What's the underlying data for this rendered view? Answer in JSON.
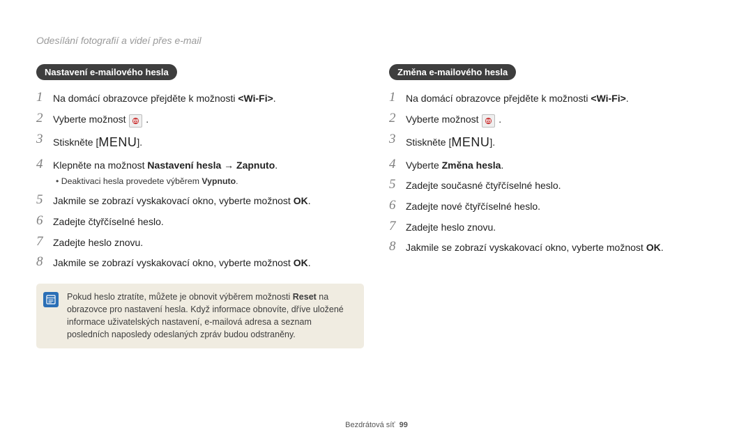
{
  "breadcrumb": "Odesílání fotografií a videí přes e-mail",
  "left": {
    "heading": "Nastavení e-mailového hesla",
    "steps": [
      {
        "n": "1",
        "pre": "Na domácí obrazovce přejděte k možnosti ",
        "bold": "<Wi-Fi>",
        "post": "."
      },
      {
        "n": "2",
        "pre": "Vyberte možnost ",
        "icon": true,
        "post": " ."
      },
      {
        "n": "3",
        "pre": "Stiskněte [",
        "menu": "MENU",
        "post": "]."
      },
      {
        "n": "4",
        "pre": "Klepněte na možnost ",
        "bold": "Nastavení hesla → Zapnuto",
        "post": ".",
        "sub": {
          "pre": "Deaktivaci hesla provedete výběrem ",
          "bold": "Vypnuto",
          "post": "."
        }
      },
      {
        "n": "5",
        "pre": "Jakmile se zobrazí vyskakovací okno, vyberte možnost ",
        "bold": "OK",
        "post": "."
      },
      {
        "n": "6",
        "pre": "Zadejte čtyřčíselné heslo."
      },
      {
        "n": "7",
        "pre": "Zadejte heslo znovu."
      },
      {
        "n": "8",
        "pre": "Jakmile se zobrazí vyskakovací okno, vyberte možnost ",
        "bold": "OK",
        "post": "."
      }
    ],
    "note": {
      "t1": "Pokud heslo ztratíte, můžete je obnovit výběrem možnosti ",
      "b": "Reset",
      "t2": " na obrazovce pro nastavení hesla. Když informace obnovíte, dříve uložené informace uživatelských nastavení, e-mailová adresa a seznam posledních naposledy odeslaných zpráv budou odstraněny."
    }
  },
  "right": {
    "heading": "Změna e-mailového hesla",
    "steps": [
      {
        "n": "1",
        "pre": "Na domácí obrazovce přejděte k možnosti ",
        "bold": "<Wi-Fi>",
        "post": "."
      },
      {
        "n": "2",
        "pre": "Vyberte možnost ",
        "icon": true,
        "post": " ."
      },
      {
        "n": "3",
        "pre": "Stiskněte [",
        "menu": "MENU",
        "post": "]."
      },
      {
        "n": "4",
        "pre": "Vyberte ",
        "bold": "Změna hesla",
        "post": "."
      },
      {
        "n": "5",
        "pre": "Zadejte současné čtyřčíselné heslo."
      },
      {
        "n": "6",
        "pre": "Zadejte nové čtyřčíselné heslo."
      },
      {
        "n": "7",
        "pre": "Zadejte heslo znovu."
      },
      {
        "n": "8",
        "pre": "Jakmile se zobrazí vyskakovací okno, vyberte možnost ",
        "bold": "OK",
        "post": "."
      }
    ]
  },
  "footer": {
    "section": "Bezdrátová síť",
    "page": "99"
  }
}
